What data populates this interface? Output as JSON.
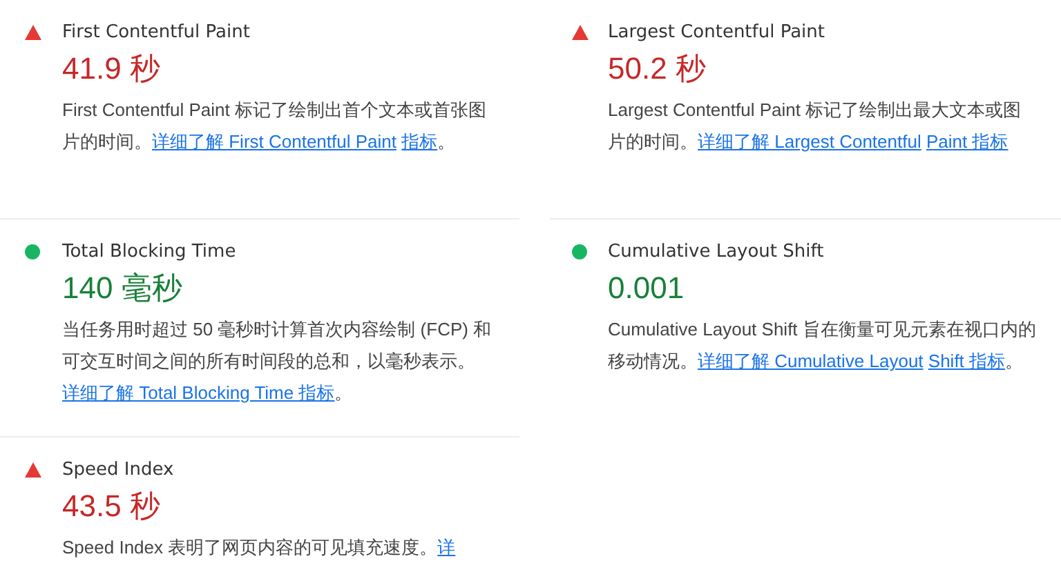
{
  "metrics": [
    {
      "kind": "fail",
      "title": "First Contentful Paint",
      "value": "41.9 秒",
      "description": "First Contentful Paint 标记了绘制出首个文本或首张图片的时间。",
      "links": [
        "详细了解 First Contentful Paint",
        "指标"
      ],
      "after": "。"
    },
    {
      "kind": "fail",
      "title": "Largest Contentful Paint",
      "value": "50.2 秒",
      "description": "Largest Contentful Paint 标记了绘制出最大文本或图片的时间。",
      "links": [
        "详细了解 Largest Contentful",
        "Paint 指标"
      ]
    },
    {
      "kind": "pass",
      "title": "Total Blocking Time",
      "value": "140 毫秒",
      "description": "当任务用时超过 50 毫秒时计算首次内容绘制 (FCP) 和可交互时间之间的所有时间段的总和，以毫秒表示。",
      "links": [
        "详细了解 Total Blocking Time 指标"
      ],
      "after": "。"
    },
    {
      "kind": "pass",
      "title": "Cumulative Layout Shift",
      "value": "0.001",
      "description": "Cumulative Layout Shift 旨在衡量可见元素在视口内的移动情况。",
      "links": [
        "详细了解 Cumulative Layout",
        "Shift 指标"
      ],
      "after": "。"
    },
    {
      "kind": "fail",
      "title": "Speed Index",
      "value": "43.5 秒",
      "description": "Speed Index 表明了网页内容的可见填充速度。",
      "links": [
        "详"
      ]
    }
  ]
}
